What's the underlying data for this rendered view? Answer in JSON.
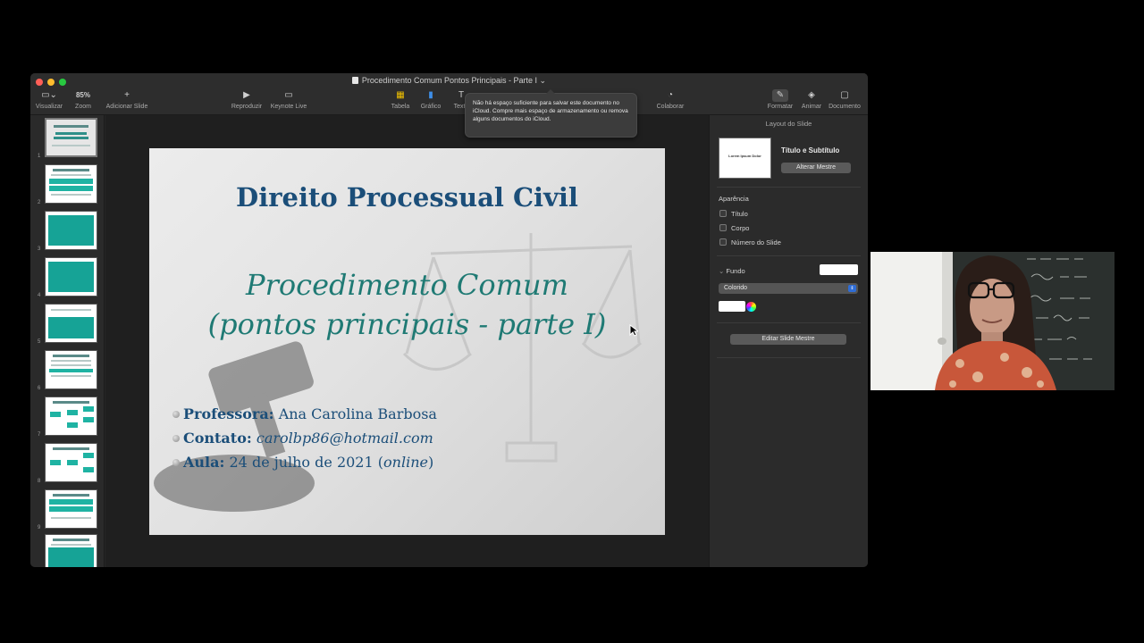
{
  "window": {
    "title": "Procedimento Comum Pontos Principais - Parte I",
    "title_chevron": "⌄"
  },
  "toolbar": {
    "visualizar": "Visualizar",
    "zoom_value": "85%",
    "zoom_label": "Zoom",
    "add_slide": "Adicionar Slide",
    "reproduzir": "Reproduzir",
    "keynote_live": "Keynote Live",
    "tabela": "Tabela",
    "grafico": "Gráfico",
    "texto": "Texto",
    "colaborar": "Colaborar",
    "formatar": "Formatar",
    "animar": "Animar",
    "documento": "Documento"
  },
  "tooltip": {
    "text": "Não há espaço suficiente para salvar este documento no iCloud. Compre mais espaço de armazenamento ou remova alguns documentos do iCloud."
  },
  "navigator": {
    "slide_numbers": [
      "1",
      "2",
      "3",
      "4",
      "5",
      "6",
      "7",
      "8",
      "9"
    ]
  },
  "slide": {
    "title": "Direito Processual Civil",
    "subtitle_line1": "Procedimento Comum",
    "subtitle_line2": "(pontos principais - parte I)",
    "professor_label": "Professora:",
    "professor_value": "Ana Carolina Barbosa",
    "contact_label": "Contato:",
    "contact_value": "carolbp86@hotmail.com",
    "class_label": "Aula:",
    "class_value": "24 de julho de 2021",
    "class_paren_open": "(",
    "class_mode": "online",
    "class_paren_close": ")"
  },
  "inspector": {
    "header": "Layout do Slide",
    "preview_text": "Lorem Ipsum Dolor",
    "layout_name": "Título e Subtítulo",
    "alterar_mestre": "Alterar Mestre",
    "aparencia": "Aparência",
    "titulo": "Título",
    "corpo": "Corpo",
    "numero_slide": "Número do Slide",
    "fundo": "Fundo",
    "fill_type": "Colorido",
    "editar_mestre": "Editar Slide Mestre"
  },
  "colors": {
    "slide_title": "#1b4e79",
    "slide_subtitle": "#1f7a74",
    "thumb_accent": "#1fb3a3"
  }
}
